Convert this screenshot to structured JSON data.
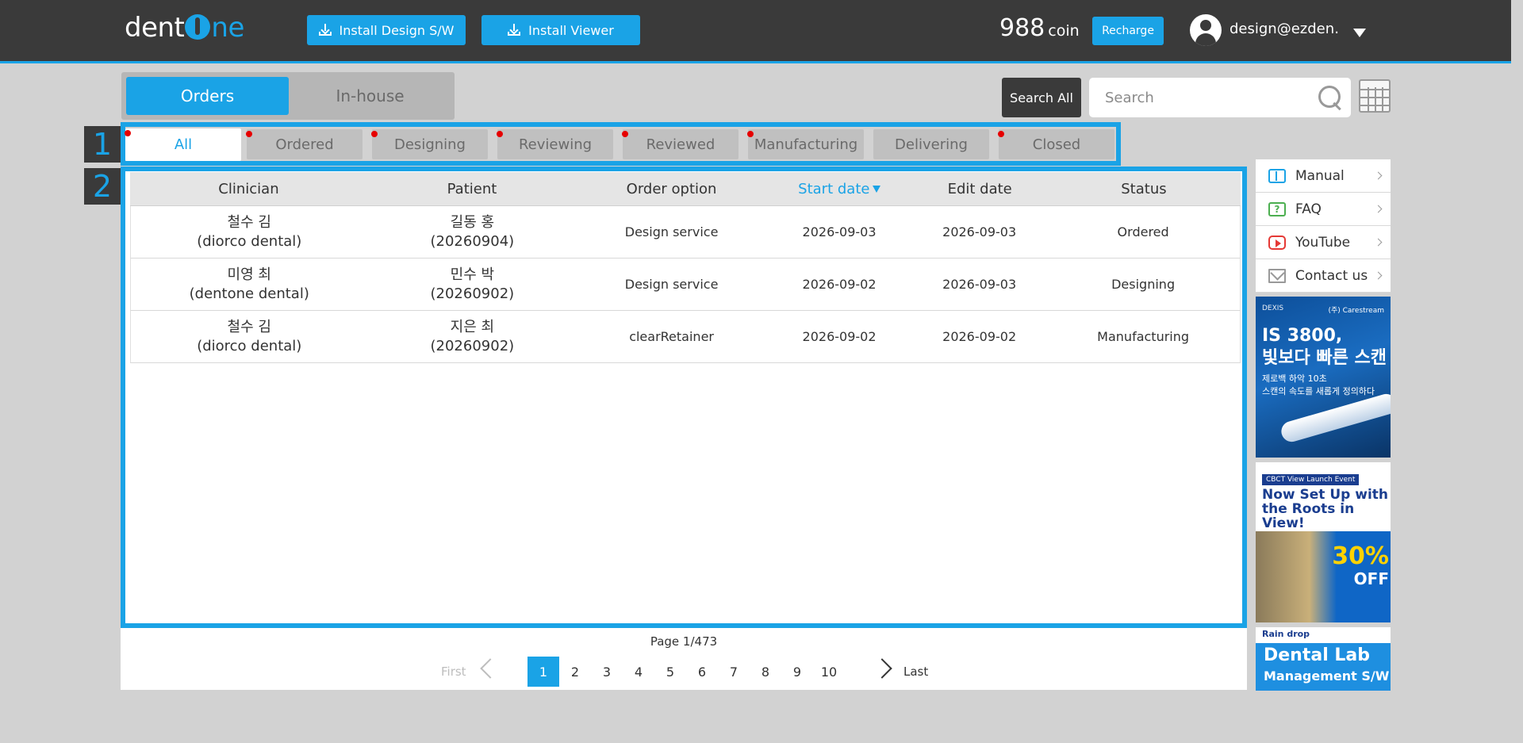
{
  "header": {
    "logo": {
      "part1": "dent",
      "part2": "ne"
    },
    "install_design": "Install Design S/W",
    "install_viewer": "Install Viewer",
    "coin_amount": "988",
    "coin_unit": "coin",
    "recharge": "Recharge",
    "user_email": "design@ezden…"
  },
  "main_tabs": [
    {
      "label": "Orders",
      "active": true
    },
    {
      "label": "In-house",
      "active": false
    }
  ],
  "search": {
    "button": "Search All",
    "placeholder": "Search"
  },
  "markers": {
    "m1": "1",
    "m2": "2"
  },
  "status_tabs": [
    {
      "label": "All",
      "active": true,
      "dot": true
    },
    {
      "label": "Ordered",
      "active": false,
      "dot": true
    },
    {
      "label": "Designing",
      "active": false,
      "dot": true
    },
    {
      "label": "Reviewing",
      "active": false,
      "dot": true
    },
    {
      "label": "Reviewed",
      "active": false,
      "dot": true
    },
    {
      "label": "Manufacturing",
      "active": false,
      "dot": true
    },
    {
      "label": "Delivering",
      "active": false,
      "dot": false
    },
    {
      "label": "Closed",
      "active": false,
      "dot": true
    }
  ],
  "table": {
    "headers": {
      "clinician": "Clinician",
      "patient": "Patient",
      "order_option": "Order option",
      "start_date": "Start date",
      "edit_date": "Edit date",
      "status": "Status"
    },
    "rows": [
      {
        "clinician_name": "철수 김",
        "clinician_org": "(diorco dental)",
        "patient_name": "길동 홍",
        "patient_id": "(20260904)",
        "order_option": "Design service",
        "start_date": "2026-09-03",
        "edit_date": "2026-09-03",
        "status": "Ordered"
      },
      {
        "clinician_name": "미영 최",
        "clinician_org": "(dentone dental)",
        "patient_name": "민수 박",
        "patient_id": "(20260902)",
        "order_option": "Design service",
        "start_date": "2026-09-02",
        "edit_date": "2026-09-03",
        "status": "Designing"
      },
      {
        "clinician_name": "철수 김",
        "clinician_org": "(diorco dental)",
        "patient_name": "지은 최",
        "patient_id": "(20260902)",
        "order_option": "clearRetainer",
        "start_date": "2026-09-02",
        "edit_date": "2026-09-02",
        "status": "Manufacturing"
      }
    ]
  },
  "pagination": {
    "info": "Page 1/473",
    "first": "First",
    "last": "Last",
    "pages": [
      "1",
      "2",
      "3",
      "4",
      "5",
      "6",
      "7",
      "8",
      "9",
      "10"
    ],
    "current": "1"
  },
  "side_links": [
    {
      "label": "Manual",
      "icon": "book-icon"
    },
    {
      "label": "FAQ",
      "icon": "question-icon"
    },
    {
      "label": "YouTube",
      "icon": "youtube-icon"
    },
    {
      "label": "Contact us",
      "icon": "mail-icon"
    }
  ],
  "ads": {
    "ad1": {
      "brand": "DEXIS",
      "brand2": "(주) Carestream",
      "headline1": "IS 3800,",
      "headline2": "빛보다 빠른 스캔",
      "sub1": "제로백 하악 10초",
      "sub2": "스캔의 속도를 새롭게 정의하다"
    },
    "ad2": {
      "tag": "CBCT View Launch Event",
      "headline": "Now Set Up with the Roots in View!",
      "off_pct": "30%",
      "off_word": "OFF"
    },
    "ad3": {
      "brand": "Rain drop",
      "headline": "Dental Lab",
      "sub": "Management S/W"
    }
  },
  "colors": {
    "accent": "#1aa3e6",
    "header_bg": "#3a3a3a",
    "dot": "#e60000"
  }
}
